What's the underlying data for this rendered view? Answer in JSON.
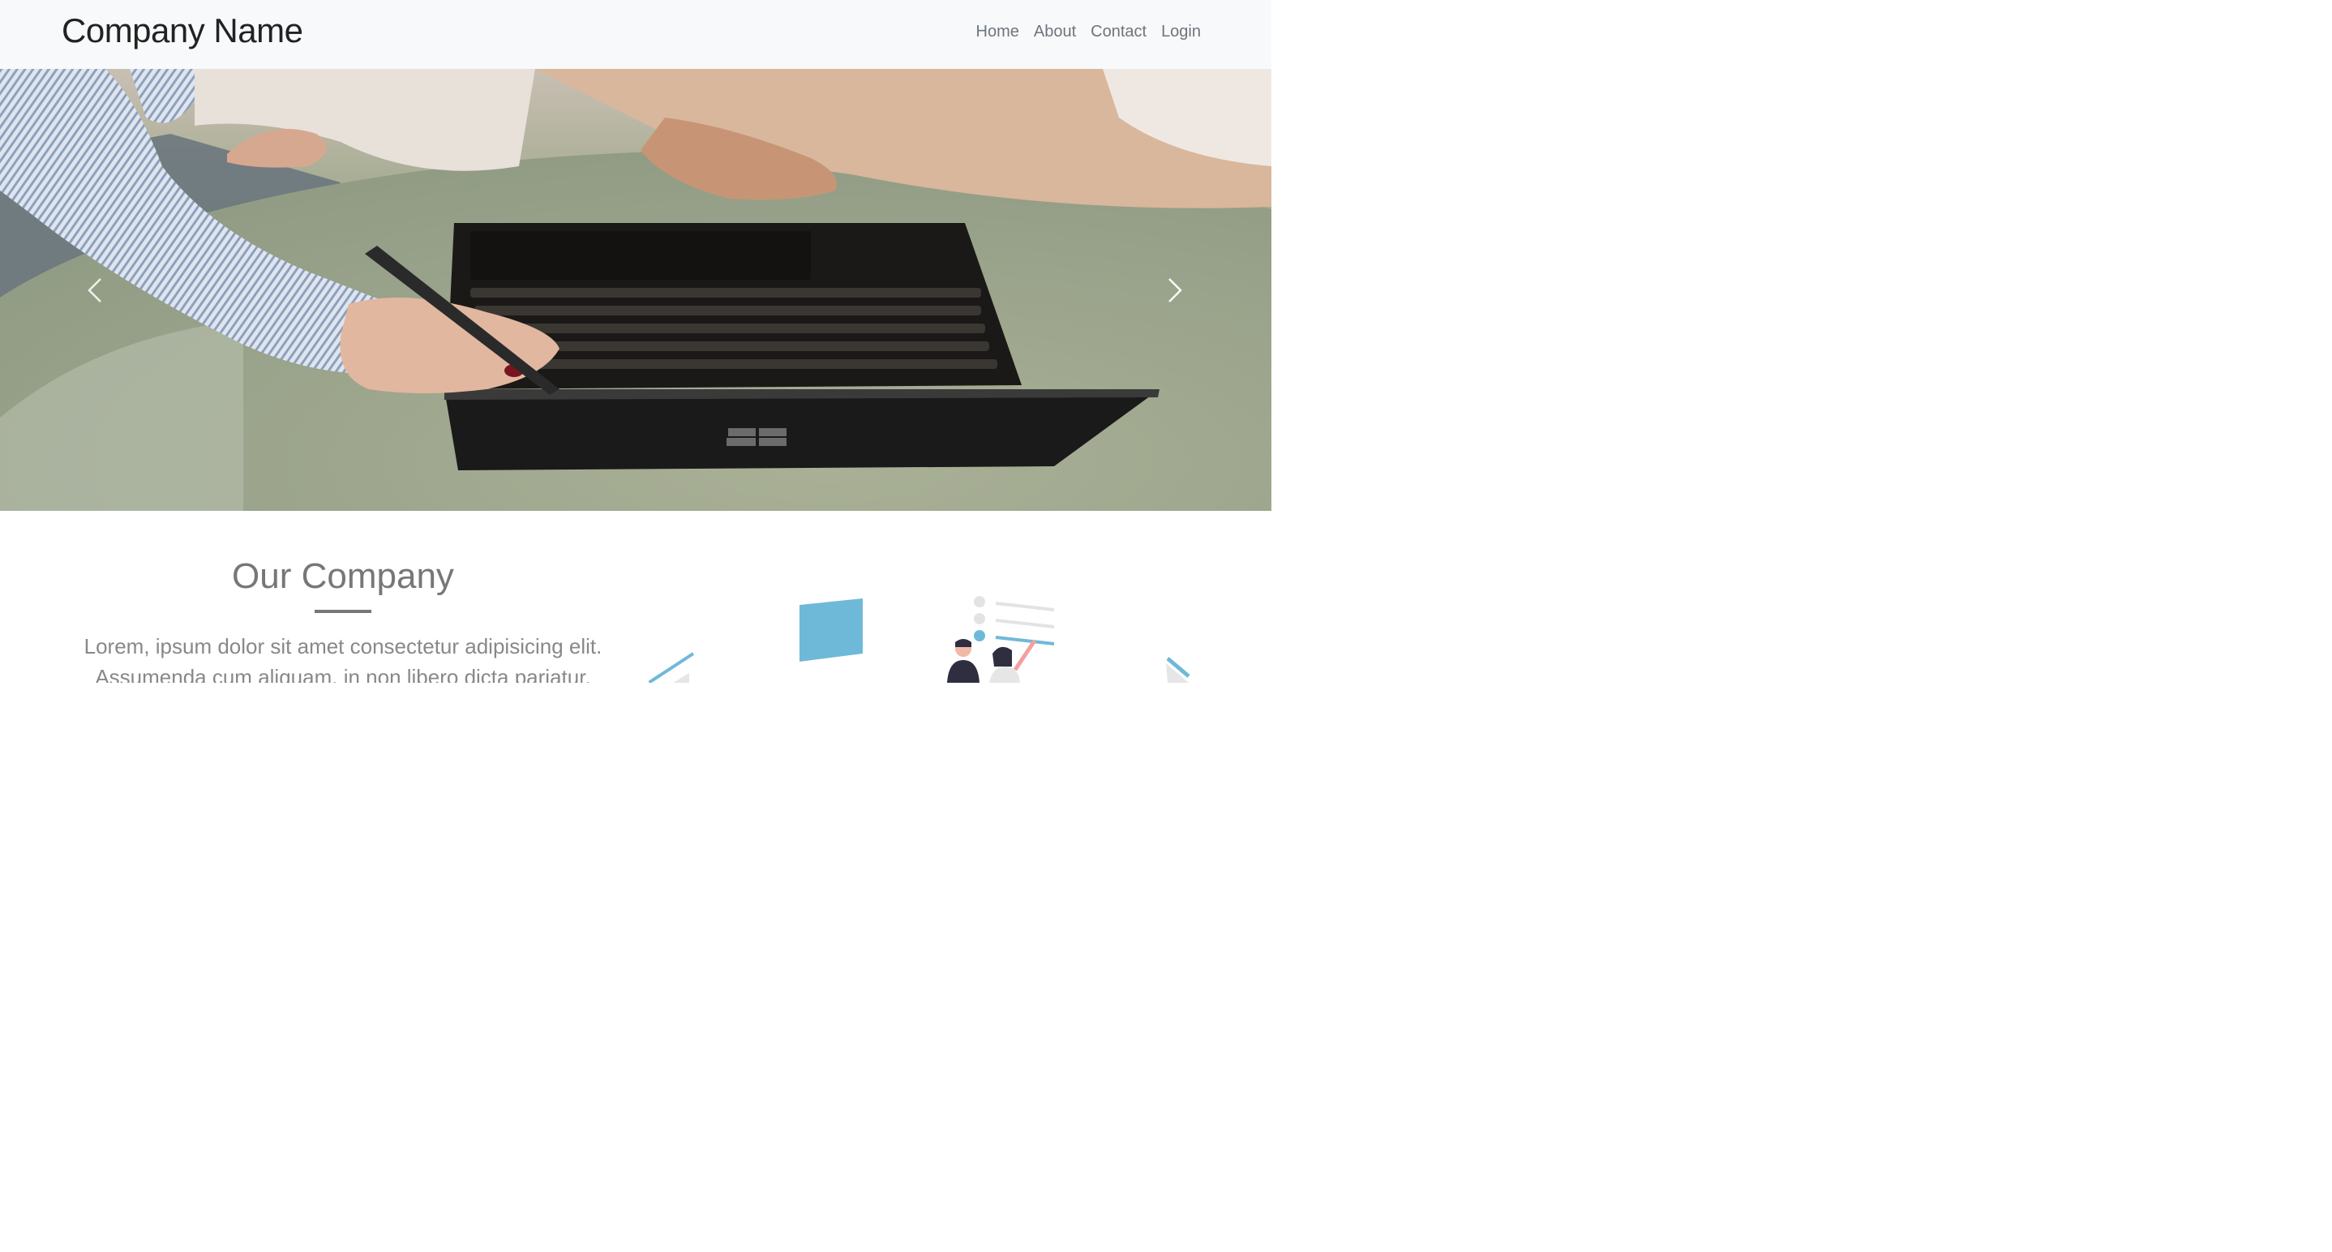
{
  "navbar": {
    "brand": "Company Name",
    "links": [
      {
        "label": "Home"
      },
      {
        "label": "About"
      },
      {
        "label": "Contact"
      },
      {
        "label": "Login"
      }
    ]
  },
  "carousel": {
    "prev_icon": "chevron-left-icon",
    "next_icon": "chevron-right-icon"
  },
  "about": {
    "title": "Our Company",
    "text": "Lorem, ipsum dolor sit amet consectetur adipisicing elit. Assumenda cum aliquam, in non libero dicta pariatur."
  },
  "colors": {
    "navbar_bg": "#f8f9fa",
    "accent": "#6fb9d8",
    "heading": "#777777"
  }
}
